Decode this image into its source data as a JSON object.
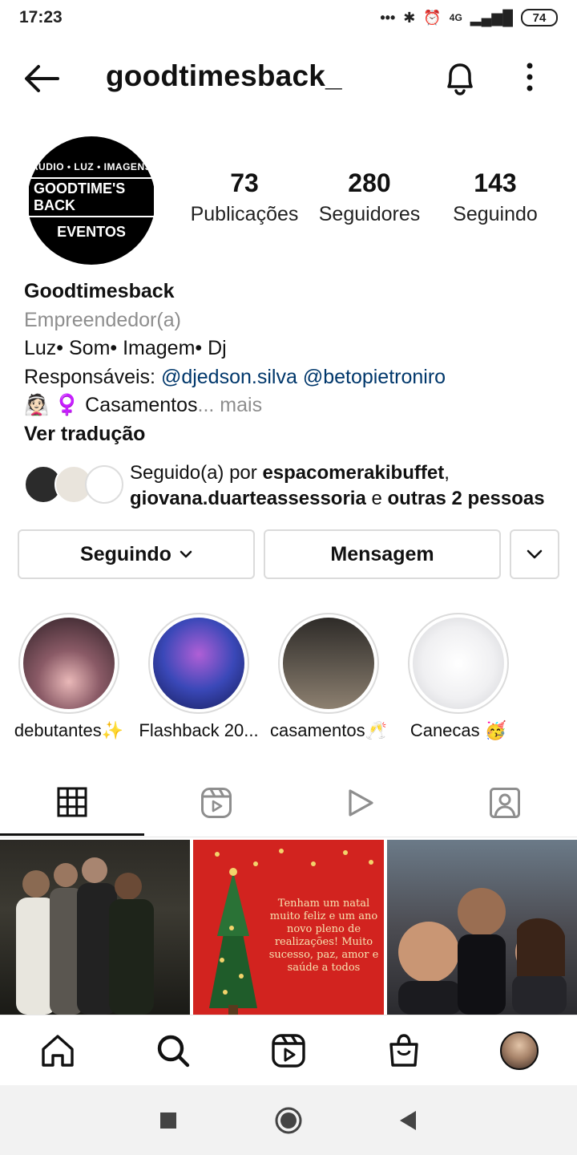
{
  "status_bar": {
    "time": "17:23",
    "network": "4G",
    "battery": "74"
  },
  "header": {
    "username": "goodtimesback_"
  },
  "profile": {
    "avatar_lines": [
      "AUDIO • LUZ • IMAGENS",
      "GOODTIME'S BACK",
      "EVENTOS"
    ],
    "stats": [
      {
        "value": "73",
        "label": "Publicações"
      },
      {
        "value": "280",
        "label": "Seguidores"
      },
      {
        "value": "143",
        "label": "Seguindo"
      }
    ],
    "bio": {
      "name": "Goodtimesback",
      "category": "Empreendedor(a)",
      "line1": "Luz• Som• Imagem• Dj",
      "resp_label": "Responsáveis:",
      "mention1": "@djedson.silva",
      "mention2": "@betopietroniro",
      "line3_emoji": "👰🏻 ♀️",
      "line3_text": "Casamentos",
      "more": "... mais",
      "translate": "Ver tradução"
    }
  },
  "followed_by": {
    "prefix": "Seguido(a) por",
    "user1": "espacomerakibuffet",
    "user2": "giovana.duarteassessoria",
    "connector": "e",
    "others": "outras 2 pessoas"
  },
  "buttons": {
    "following": "Seguindo",
    "message": "Mensagem"
  },
  "highlights": [
    {
      "label": "debutantes✨",
      "color": "#6b4f5c"
    },
    {
      "label": "Flashback 20...",
      "color": "#2a3a8c"
    },
    {
      "label": "casamentos🥂",
      "color": "#3a3530"
    },
    {
      "label": "Canecas 🥳",
      "color": "#e8e8ea"
    }
  ],
  "tabs": [
    "grid-icon",
    "reels-icon",
    "video-icon",
    "tagged-icon"
  ],
  "posts": {
    "xmas_text": "Tenham um natal muito feliz e um ano novo pleno de realizações! Muito sucesso, paz, amor e saúde a todos"
  },
  "bottom_nav": [
    "home-icon",
    "search-icon",
    "reels-icon",
    "shop-icon",
    "profile-avatar"
  ]
}
